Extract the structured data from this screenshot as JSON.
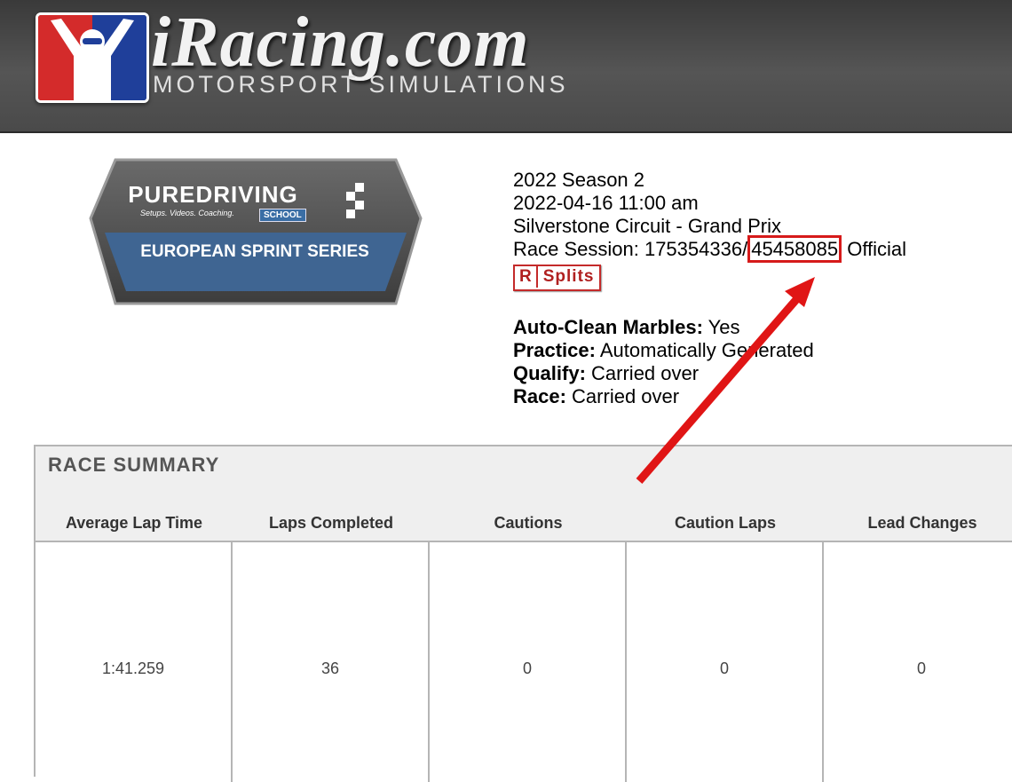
{
  "header": {
    "brand": "iRacing.com",
    "tagline": "MOTORSPORT SIMULATIONS"
  },
  "series_badge": {
    "brand": "PUREDRIVING",
    "tagline": "Setups. Videos. Coaching.",
    "school": "SCHOOL",
    "series": "EUROPEAN SPRINT SERIES"
  },
  "session": {
    "season": "2022 Season 2",
    "datetime": "2022-04-16 11:00 am",
    "track": "Silverstone Circuit - Grand Prix",
    "race_session_label": "Race Session: 175354336/",
    "race_session_id": "45458085",
    "status": "Official",
    "splits_r": "R",
    "splits_label": "Splits"
  },
  "settings": {
    "marbles_label": "Auto-Clean Marbles:",
    "marbles_value": "Yes",
    "practice_label": "Practice:",
    "practice_value": "Automatically Generated",
    "qualify_label": "Qualify:",
    "qualify_value": "Carried over",
    "race_label": "Race:",
    "race_value": "Carried over"
  },
  "race_summary": {
    "title": "RACE SUMMARY",
    "headers": [
      "Average Lap Time",
      "Laps Completed",
      "Cautions",
      "Caution Laps",
      "Lead Changes"
    ],
    "values": [
      "1:41.259",
      "36",
      "0",
      "0",
      "0"
    ]
  },
  "colors": {
    "header_bg": "#4a4a4a",
    "annotation_red": "#e01515",
    "summary_bg": "#efefef",
    "badge_blue": "#3a6ea5"
  }
}
